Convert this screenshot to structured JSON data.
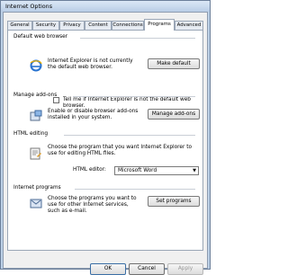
{
  "window": {
    "title": "Internet Options"
  },
  "tabs": [
    {
      "label": "General",
      "active": false
    },
    {
      "label": "Security",
      "active": false
    },
    {
      "label": "Privacy",
      "active": false
    },
    {
      "label": "Content",
      "active": false
    },
    {
      "label": "Connections",
      "active": false
    },
    {
      "label": "Programs",
      "active": true
    },
    {
      "label": "Advanced",
      "active": false
    }
  ],
  "default_browser": {
    "title": "Default web browser",
    "text": "Internet Explorer is not currently the default web browser.",
    "button": "Make default",
    "checkbox_label": "Tell me if Internet Explorer is not the default web browser.",
    "checkbox_checked": false
  },
  "addons": {
    "title": "Manage add-ons",
    "text": "Enable or disable browser add-ons installed in your system.",
    "button": "Manage add-ons"
  },
  "html_editing": {
    "title": "HTML editing",
    "text": "Choose the program that you want Internet Explorer to use for editing HTML files.",
    "editor_label": "HTML editor:",
    "editor_value": "Microsoft Word"
  },
  "internet_programs": {
    "title": "Internet programs",
    "text": "Choose the programs you want to use for other Internet services, such as e-mail.",
    "button": "Set programs"
  },
  "footer": {
    "ok": "OK",
    "cancel": "Cancel",
    "apply": "Apply"
  },
  "icons": {
    "browser": "internet-explorer-icon",
    "addons": "addons-icon",
    "editing": "html-editing-icon",
    "programs": "programs-icon"
  }
}
